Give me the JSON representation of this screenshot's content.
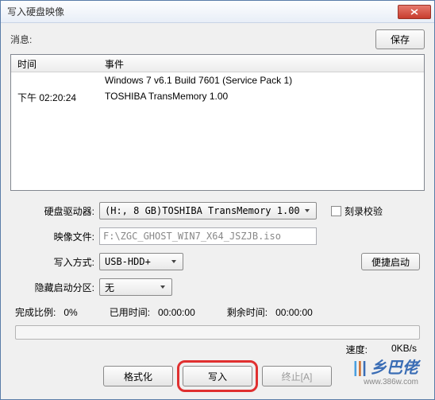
{
  "window": {
    "title": "写入硬盘映像"
  },
  "topbar": {
    "message_label": "消息:",
    "save_label": "保存"
  },
  "log": {
    "col_time": "时间",
    "col_event": "事件",
    "rows": [
      {
        "time": "",
        "event": "Windows 7 v6.1 Build 7601 (Service Pack 1)"
      },
      {
        "time": "下午 02:20:24",
        "event": "TOSHIBA TransMemory    1.00"
      }
    ]
  },
  "form": {
    "drive_label": "硬盘驱动器:",
    "drive_value": "(H:, 8 GB)TOSHIBA TransMemory    1.00",
    "verify_checkbox": "刻录校验",
    "image_label": "映像文件:",
    "image_value": "F:\\ZGC_GHOST_WIN7_X64_JSZJB.iso",
    "write_method_label": "写入方式:",
    "write_method_value": "USB-HDD+",
    "quick_boot_label": "便捷启动",
    "hidden_partition_label": "隐藏启动分区:",
    "hidden_partition_value": "无"
  },
  "stats": {
    "completed_label": "完成比例:",
    "completed_value": "0%",
    "elapsed_label": "已用时间:",
    "elapsed_value": "00:00:00",
    "remaining_label": "剩余时间:",
    "remaining_value": "00:00:00",
    "speed_label": "速度:",
    "speed_value": "0KB/s"
  },
  "buttons": {
    "format": "格式化",
    "write": "写入",
    "abort": "终止[A]"
  },
  "watermark": {
    "brand": "乡巴佬",
    "url": "www.386w.com"
  }
}
